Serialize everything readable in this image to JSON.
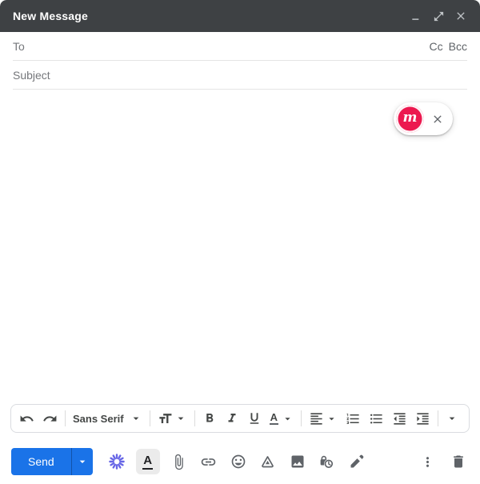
{
  "window": {
    "title": "New Message"
  },
  "recipients": {
    "to_label": "To",
    "cc_label": "Cc",
    "bcc_label": "Bcc"
  },
  "subject": {
    "placeholder": "Subject"
  },
  "body_text": "",
  "extension_chip": {
    "logo_letter": "m"
  },
  "toolbar": {
    "font_name": "Sans Serif",
    "text_color_letter": "A",
    "icons": [
      "undo-icon",
      "redo-icon",
      "chevron-down-icon",
      "text-size-icon",
      "bold-icon",
      "italic-icon",
      "underline-icon",
      "text-color-icon",
      "align-left-icon",
      "numbered-list-icon",
      "bulleted-list-icon",
      "outdent-icon",
      "indent-icon",
      "more-formatting-icon"
    ]
  },
  "bottombar": {
    "send_label": "Send",
    "formatting_toggle_letter": "A",
    "icons": [
      "ai-sparkle-icon",
      "formatting-options-icon",
      "paperclip-icon",
      "link-icon",
      "emoji-icon",
      "drive-icon",
      "image-icon",
      "confidential-lock-clock-icon",
      "pen-icon",
      "more-vert-icon",
      "trash-icon"
    ]
  },
  "titlebar_icons": [
    "minimize-icon",
    "expand-icon",
    "close-icon"
  ],
  "colors": {
    "titlebar_bg": "#3E4144",
    "send_blue": "#1A73E8",
    "chip_pink": "#EC184F",
    "ai_purple": "#6766E6",
    "icon_gray": "#5F6368",
    "toolbar_border": "#DADCE0"
  }
}
